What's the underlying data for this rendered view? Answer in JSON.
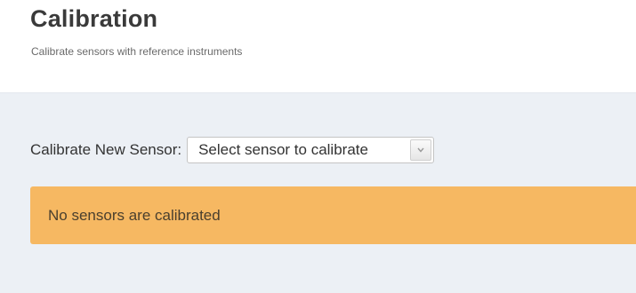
{
  "header": {
    "title": "Calibration",
    "subtitle": "Calibrate sensors with reference instruments"
  },
  "calibrate": {
    "label": "Calibrate New Sensor:",
    "select_value": "Select sensor to calibrate",
    "dropdown_icon": "chevron-down-icon"
  },
  "alert": {
    "message": "No sensors are calibrated",
    "color": "#f6b862"
  },
  "colors": {
    "content_background": "#ecf0f5",
    "title_text": "#3a3a3a"
  }
}
